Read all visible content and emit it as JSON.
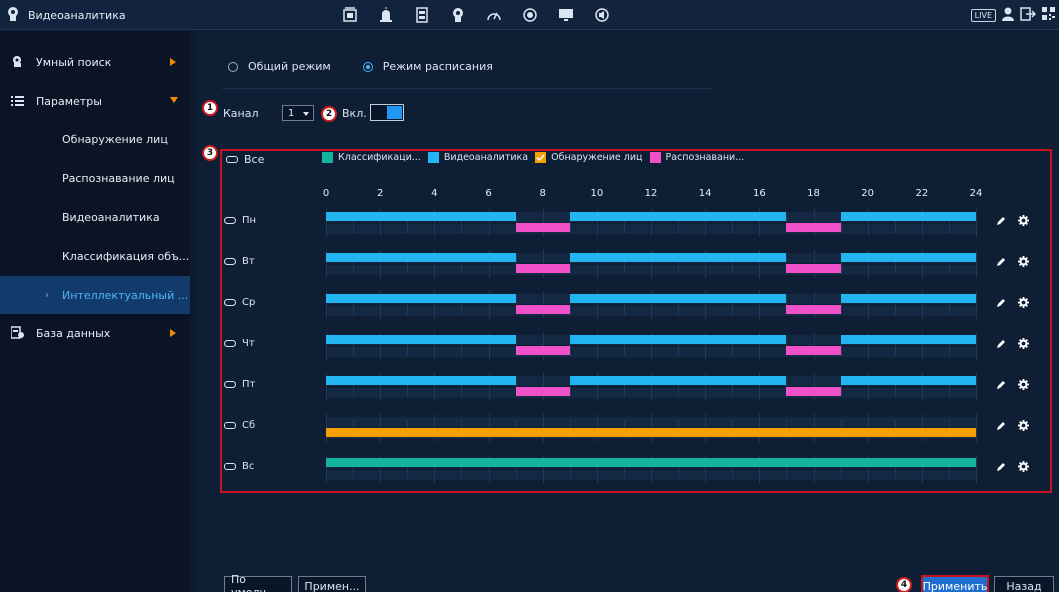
{
  "app": {
    "title": "Видеоаналитика",
    "brand_icon": "head-profile-icon",
    "accent": "#2196f3"
  },
  "topbar": {
    "nav_icons": [
      "intelligent-video-icon",
      "alarm-light-icon",
      "storage-icon",
      "face-head-icon",
      "speedometer-icon",
      "record-icon",
      "monitor-icon",
      "speaker-icon"
    ],
    "live_label": "LIVE",
    "right_icons": [
      "user-icon",
      "logout-icon",
      "qr-code-icon"
    ]
  },
  "sidebar": {
    "items": [
      {
        "label": "Умный поиск",
        "icon": "smart-search-icon",
        "arrow": "right"
      },
      {
        "label": "Параметры",
        "icon": "list-icon",
        "arrow": "down"
      },
      {
        "label": "Обнаружение лиц"
      },
      {
        "label": "Распознавание лиц"
      },
      {
        "label": "Видеоаналитика"
      },
      {
        "label": "Классификация объ..."
      },
      {
        "label": "Интеллектуальный ...",
        "active": true
      },
      {
        "label": "База данных",
        "icon": "database-icon",
        "arrow": "right"
      }
    ]
  },
  "mode": {
    "option_general": "Общий режим",
    "option_schedule": "Режим расписания",
    "selected": "Режим расписания"
  },
  "channel": {
    "label": "Канал",
    "value": "1",
    "enable_label": "Вкл."
  },
  "badges": [
    "1",
    "2",
    "3",
    "4"
  ],
  "schedule": {
    "all_label": "Все",
    "legend": [
      {
        "label": "Классификаци...",
        "color": "#14b3a0",
        "checked": false
      },
      {
        "label": "Видеоаналитика",
        "color": "#22b5f0",
        "checked": false
      },
      {
        "label": "Обнаружение лиц",
        "color": "#f5a000",
        "checked": true
      },
      {
        "label": "Распознавани...",
        "color": "#f050c8",
        "checked": false
      }
    ],
    "hour_ticks": [
      "0",
      "2",
      "4",
      "6",
      "8",
      "10",
      "12",
      "14",
      "16",
      "18",
      "20",
      "22",
      "24"
    ],
    "days": [
      {
        "label": "Пн",
        "linked": true
      },
      {
        "label": "Вт",
        "linked": true
      },
      {
        "label": "Ср",
        "linked": true
      },
      {
        "label": "Чт",
        "linked": true
      },
      {
        "label": "Пт",
        "linked": true
      },
      {
        "label": "Сб",
        "linked": false
      },
      {
        "label": "Вс",
        "linked": false
      }
    ]
  },
  "footer": {
    "default_label": "По умолч...",
    "apply_short_label": "Примен...",
    "apply_label": "Применить",
    "back_label": "Назад"
  }
}
